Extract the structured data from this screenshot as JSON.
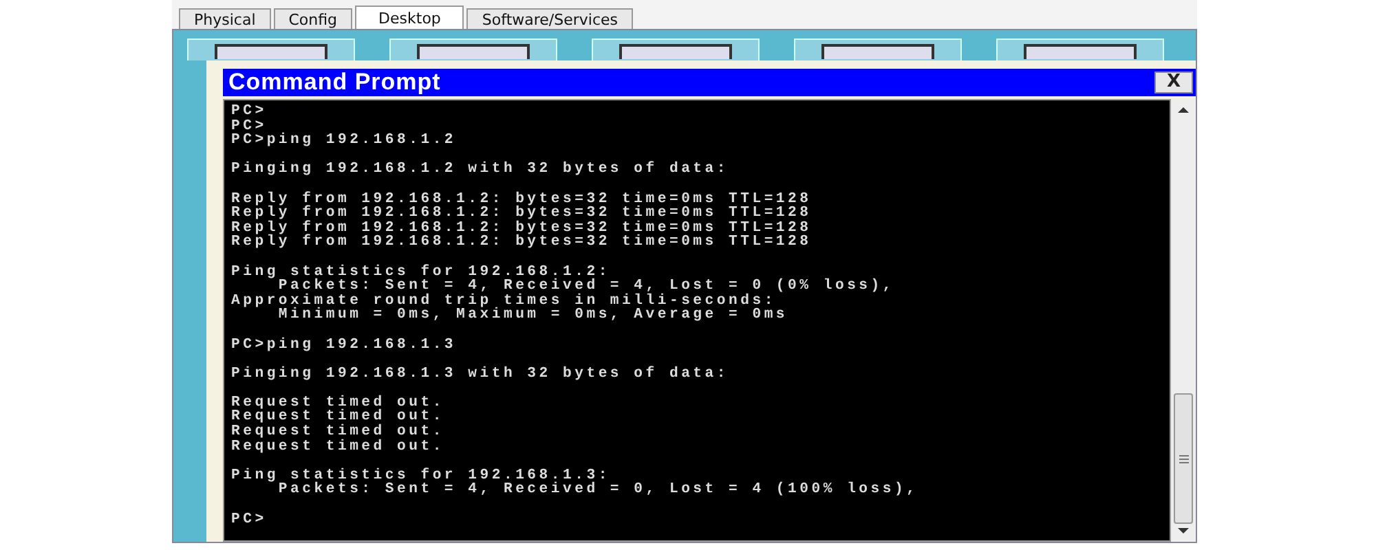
{
  "tabs": [
    {
      "label": "Physical",
      "selected": false
    },
    {
      "label": "Config",
      "selected": false
    },
    {
      "label": "Desktop",
      "selected": true
    },
    {
      "label": "Software/Services",
      "selected": false
    }
  ],
  "window": {
    "title": "Command Prompt",
    "close": "X"
  },
  "terminal": {
    "blocks": [
      [
        "PC>",
        "PC>",
        "PC>ping 192.168.1.2"
      ],
      [
        "Pinging 192.168.1.2 with 32 bytes of data:"
      ],
      [
        "Reply from 192.168.1.2: bytes=32 time=0ms TTL=128",
        "Reply from 192.168.1.2: bytes=32 time=0ms TTL=128",
        "Reply from 192.168.1.2: bytes=32 time=0ms TTL=128",
        "Reply from 192.168.1.2: bytes=32 time=0ms TTL=128"
      ],
      [
        "Ping statistics for 192.168.1.2:",
        "    Packets: Sent = 4, Received = 4, Lost = 0 (0% loss),",
        "Approximate round trip times in milli-seconds:",
        "    Minimum = 0ms, Maximum = 0ms, Average = 0ms"
      ],
      [
        "PC>ping 192.168.1.3"
      ],
      [
        "Pinging 192.168.1.3 with 32 bytes of data:"
      ],
      [
        "Request timed out.",
        "Request timed out.",
        "Request timed out.",
        "Request timed out."
      ],
      [
        "Ping statistics for 192.168.1.3:",
        "    Packets: Sent = 4, Received = 0, Lost = 4 (100% loss),"
      ],
      [
        "PC>"
      ]
    ]
  }
}
